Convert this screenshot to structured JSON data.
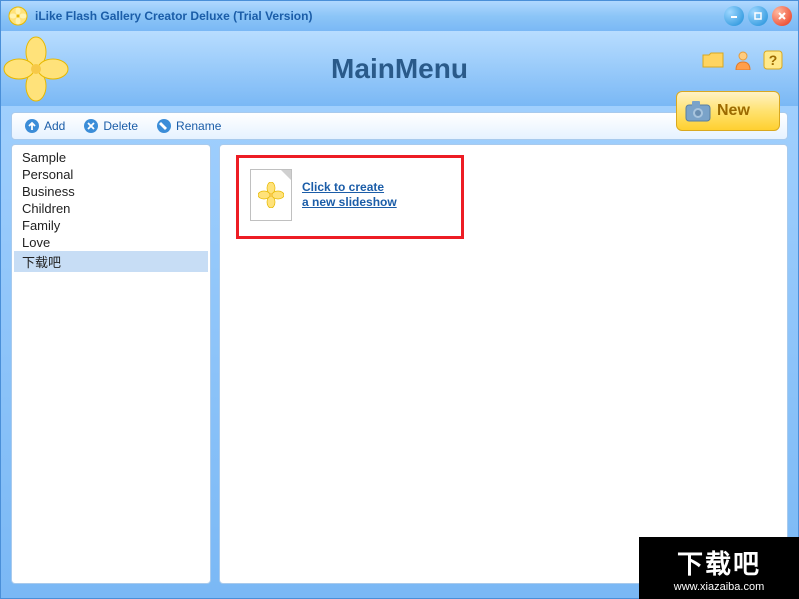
{
  "titlebar": {
    "title": "iLike Flash Gallery Creator Deluxe (Trial Version)"
  },
  "header": {
    "main_title": "MainMenu",
    "new_label": "New"
  },
  "toolbar": {
    "add": "Add",
    "delete": "Delete",
    "rename": "Rename"
  },
  "sidebar": {
    "items": [
      {
        "label": "Sample",
        "selected": false
      },
      {
        "label": "Personal",
        "selected": false
      },
      {
        "label": "Business",
        "selected": false
      },
      {
        "label": "Children",
        "selected": false
      },
      {
        "label": "Family",
        "selected": false
      },
      {
        "label": "Love",
        "selected": false
      },
      {
        "label": "下载吧",
        "selected": true
      }
    ]
  },
  "content": {
    "create_line1": "Click to create",
    "create_line2": "a new slideshow"
  },
  "watermark": {
    "big": "下载吧",
    "url": "www.xiazaiba.com"
  }
}
